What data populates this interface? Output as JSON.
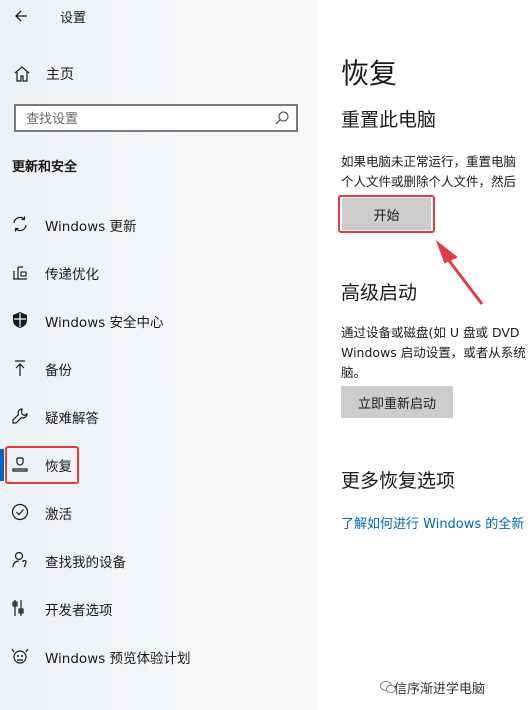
{
  "header": {
    "title": "设置"
  },
  "sidebar": {
    "home_label": "主页",
    "search_placeholder": "查找设置",
    "section_title": "更新和安全",
    "items": [
      {
        "label": "Windows 更新",
        "icon": "sync-icon"
      },
      {
        "label": "传递优化",
        "icon": "delivery-optimization-icon"
      },
      {
        "label": "Windows 安全中心",
        "icon": "shield-icon"
      },
      {
        "label": "备份",
        "icon": "backup-arrow-icon"
      },
      {
        "label": "疑难解答",
        "icon": "wrench-icon"
      },
      {
        "label": "恢复",
        "icon": "recovery-icon"
      },
      {
        "label": "激活",
        "icon": "check-circle-icon"
      },
      {
        "label": "查找我的设备",
        "icon": "person-location-icon"
      },
      {
        "label": "开发者选项",
        "icon": "developer-options-icon"
      },
      {
        "label": "Windows 预览体验计划",
        "icon": "insider-icon"
      }
    ],
    "active_item": "恢复"
  },
  "main": {
    "title": "恢复",
    "reset": {
      "heading": "重置此电脑",
      "desc_line1": "如果电脑未正常运行，重置电脑",
      "desc_line2": "个人文件或删除个人文件，然后",
      "button": "开始"
    },
    "advanced": {
      "heading": "高级启动",
      "desc_line1": "通过设备或磁盘(如 U 盘或 DVD",
      "desc_line2": "Windows 启动设置，或者从系统",
      "desc_line3": "脑。",
      "button": "立即重新启动"
    },
    "more": {
      "heading": "更多恢复选项",
      "link": "了解如何进行 Windows 的全新"
    }
  },
  "watermark": "信序渐进学电脑",
  "colors": {
    "accent": "#0067c0",
    "highlight": "#e03a45",
    "button_bg": "#cccccc"
  }
}
